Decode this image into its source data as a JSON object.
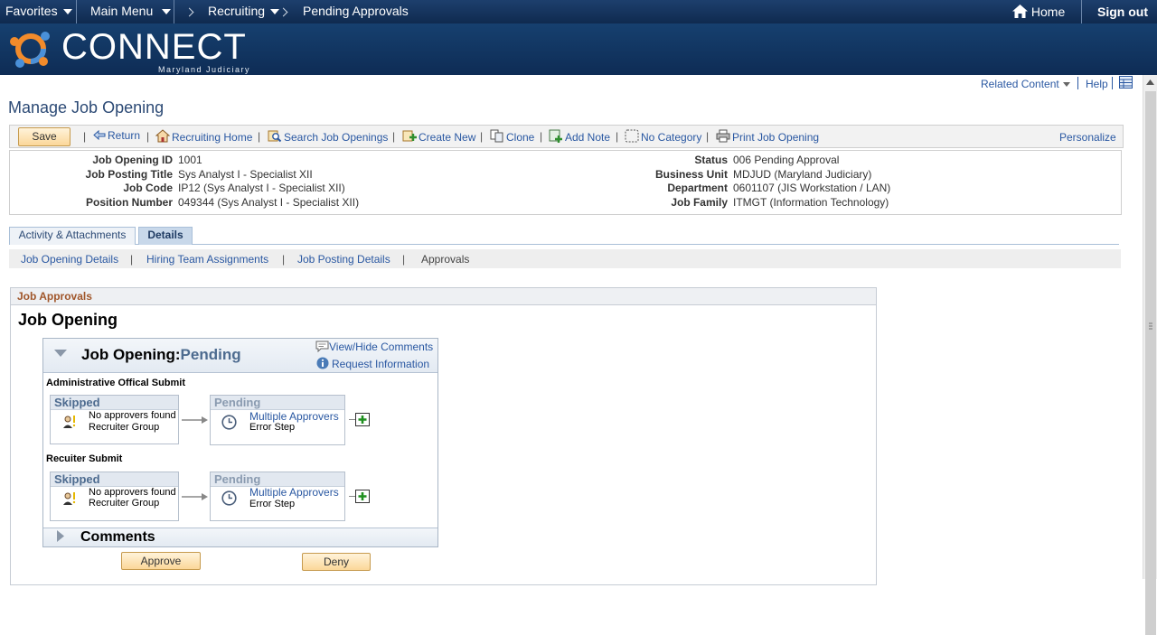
{
  "topbar": {
    "favorites": "Favorites",
    "main_menu": "Main Menu",
    "crumb_recruiting": "Recruiting",
    "crumb_current": "Pending Approvals",
    "home": "Home",
    "signout": "Sign out"
  },
  "banner": {
    "brand": "CONNECT",
    "sub": "Maryland Judiciary"
  },
  "util": {
    "related": "Related Content",
    "help": "Help"
  },
  "page_title": "Manage Job Opening",
  "toolbar": {
    "save": "Save",
    "return": "Return",
    "recruiting_home": "Recruiting Home",
    "search": "Search Job Openings",
    "create_new": "Create New",
    "clone": "Clone",
    "add_note": "Add Note",
    "no_category": "No Category",
    "print": "Print Job Opening",
    "personalize": "Personalize"
  },
  "summary": {
    "left": [
      {
        "label": "Job Opening ID",
        "value": "1001"
      },
      {
        "label": "Job Posting Title",
        "value": "Sys Analyst I - Specialist XII"
      },
      {
        "label": "Job Code",
        "value": "IP12 (Sys Analyst I - Specialist XII)"
      },
      {
        "label": "Position Number",
        "value": "049344 (Sys Analyst I - Specialist XII)"
      }
    ],
    "right": [
      {
        "label": "Status",
        "value": "006 Pending Approval"
      },
      {
        "label": "Business Unit",
        "value": "MDJUD (Maryland Judiciary)"
      },
      {
        "label": "Department",
        "value": "0601107 (JIS Workstation / LAN)"
      },
      {
        "label": "Job Family",
        "value": "ITMGT (Information Technology)"
      }
    ]
  },
  "tabs": {
    "activity": "Activity & Attachments",
    "details": "Details"
  },
  "subnav": {
    "job_opening_details": "Job Opening Details",
    "hiring_team": "Hiring Team Assignments",
    "job_posting": "Job Posting Details",
    "approvals": "Approvals"
  },
  "approvals": {
    "section_title": "Job Approvals",
    "heading": "Job Opening",
    "panel_title": "Job Opening:",
    "panel_status": "Pending",
    "view_hide": "View/Hide Comments",
    "request_info": "Request Information",
    "stages": [
      {
        "name": "Administrative Offical Submit",
        "skipped": {
          "status": "Skipped",
          "line1": "No approvers found",
          "line2": "Recruiter Group"
        },
        "pending": {
          "status": "Pending",
          "line1": "Multiple Approvers",
          "line2": "Error Step"
        }
      },
      {
        "name": "Recuiter Submit",
        "skipped": {
          "status": "Skipped",
          "line1": "No approvers found",
          "line2": "Recruiter Group"
        },
        "pending": {
          "status": "Pending",
          "line1": "Multiple Approvers",
          "line2": "Error Step"
        }
      }
    ],
    "comments": "Comments",
    "approve": "Approve",
    "deny": "Deny"
  }
}
